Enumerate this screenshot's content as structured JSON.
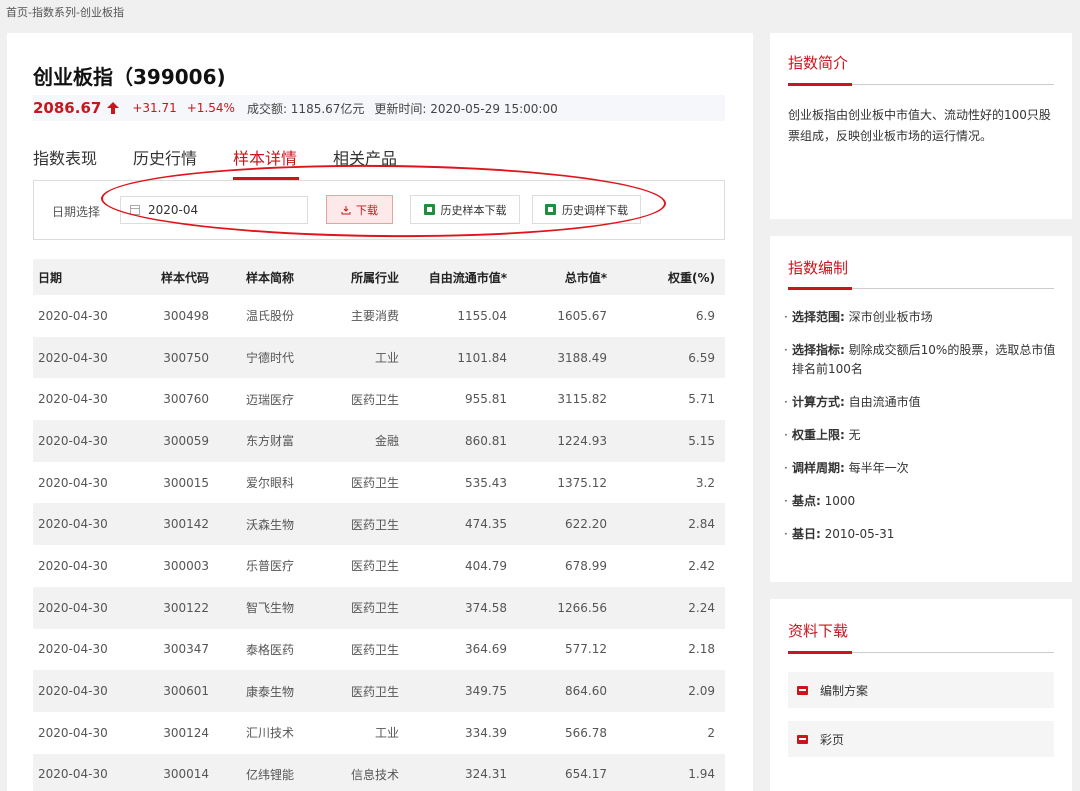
{
  "breadcrumb": "首页-指数系列-创业板指",
  "index": {
    "title": "创业板指（399006)",
    "price": "2086.67",
    "change": "+31.71",
    "change_pct": "+1.54%",
    "volume": "成交额: 1185.67亿元",
    "update_time": "更新时间: 2020-05-29 15:00:00"
  },
  "tabs": [
    "指数表现",
    "历史行情",
    "样本详情",
    "相关产品"
  ],
  "active_tab": "样本详情",
  "filter": {
    "label": "日期选择",
    "date_value": "2020-04",
    "download_label": "下载",
    "hist_sample_label": "历史样本下载",
    "hist_adjust_label": "历史调样下载"
  },
  "table": {
    "headers": [
      "日期",
      "样本代码",
      "样本简称",
      "所属行业",
      "自由流通市值*",
      "总市值*",
      "权重(%)"
    ],
    "rows": [
      [
        "2020-04-30",
        "300498",
        "温氏股份",
        "主要消费",
        "1155.04",
        "1605.67",
        "6.9"
      ],
      [
        "2020-04-30",
        "300750",
        "宁德时代",
        "工业",
        "1101.84",
        "3188.49",
        "6.59"
      ],
      [
        "2020-04-30",
        "300760",
        "迈瑞医疗",
        "医药卫生",
        "955.81",
        "3115.82",
        "5.71"
      ],
      [
        "2020-04-30",
        "300059",
        "东方财富",
        "金融",
        "860.81",
        "1224.93",
        "5.15"
      ],
      [
        "2020-04-30",
        "300015",
        "爱尔眼科",
        "医药卫生",
        "535.43",
        "1375.12",
        "3.2"
      ],
      [
        "2020-04-30",
        "300142",
        "沃森生物",
        "医药卫生",
        "474.35",
        "622.20",
        "2.84"
      ],
      [
        "2020-04-30",
        "300003",
        "乐普医疗",
        "医药卫生",
        "404.79",
        "678.99",
        "2.42"
      ],
      [
        "2020-04-30",
        "300122",
        "智飞生物",
        "医药卫生",
        "374.58",
        "1266.56",
        "2.24"
      ],
      [
        "2020-04-30",
        "300347",
        "泰格医药",
        "医药卫生",
        "364.69",
        "577.12",
        "2.18"
      ],
      [
        "2020-04-30",
        "300601",
        "康泰生物",
        "医药卫生",
        "349.75",
        "864.60",
        "2.09"
      ],
      [
        "2020-04-30",
        "300124",
        "汇川技术",
        "工业",
        "334.39",
        "566.78",
        "2"
      ],
      [
        "2020-04-30",
        "300014",
        "亿纬锂能",
        "信息技术",
        "324.31",
        "654.17",
        "1.94"
      ]
    ]
  },
  "sidebar": {
    "intro": {
      "title": "指数简介",
      "text": "创业板指由创业板中市值大、流动性好的100只股票组成，反映创业板市场的运行情况。"
    },
    "compile": {
      "title": "指数编制",
      "items": [
        {
          "key": "选择范围:",
          "value": "深市创业板市场"
        },
        {
          "key": "选择指标:",
          "value": "剔除成交额后10%的股票，选取总市值排名前100名"
        },
        {
          "key": "计算方式:",
          "value": "自由流通市值"
        },
        {
          "key": "权重上限:",
          "value": "无"
        },
        {
          "key": "调样周期:",
          "value": "每半年一次"
        },
        {
          "key": "基点:",
          "value": "1000"
        },
        {
          "key": "基日:",
          "value": "2010-05-31"
        }
      ]
    },
    "downloads": {
      "title": "资料下载",
      "items": [
        "编制方案",
        "彩页"
      ]
    }
  },
  "colors": {
    "accent": "#c8161d",
    "excel": "#1f8f3f",
    "annotation": "#e0141b"
  }
}
